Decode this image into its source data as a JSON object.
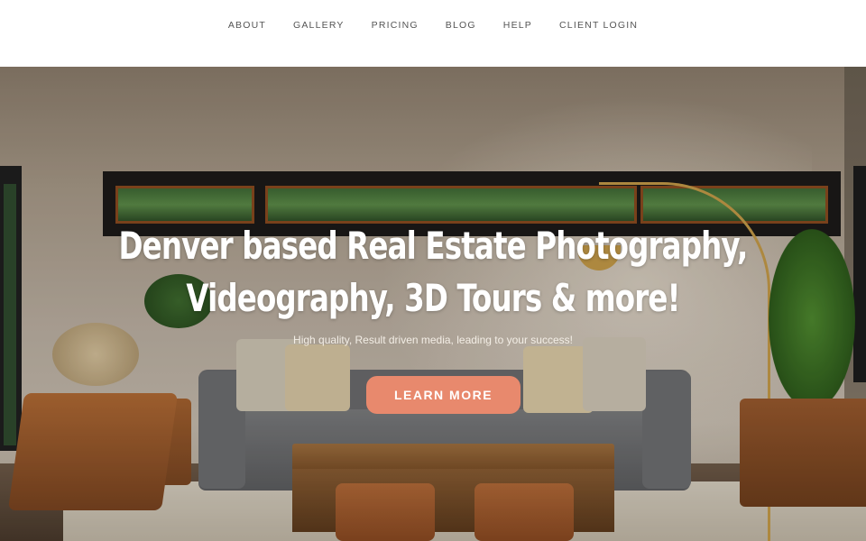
{
  "nav": {
    "items": [
      {
        "label": "ABOUT"
      },
      {
        "label": "GALLERY"
      },
      {
        "label": "PRICING"
      },
      {
        "label": "BLOG"
      },
      {
        "label": "HELP"
      },
      {
        "label": "CLIENT LOGIN"
      }
    ]
  },
  "hero": {
    "headline_line1": "Denver based Real Estate Photography,",
    "headline_line2": "Videography, 3D Tours & more!",
    "subheading": "High quality, Result driven media, leading to your success!",
    "cta_label": "LEARN MORE"
  },
  "colors": {
    "accent": "#e8896d",
    "nav_text": "#555555"
  }
}
